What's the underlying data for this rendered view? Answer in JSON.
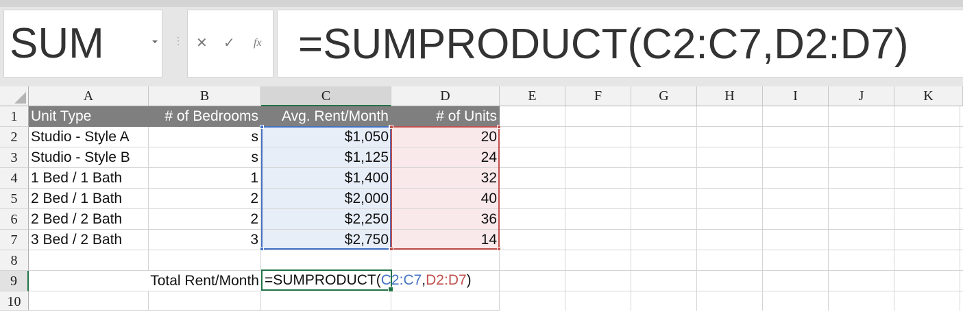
{
  "name_box": {
    "value": "SUM"
  },
  "formula_bar": {
    "cancel_glyph": "✕",
    "enter_glyph": "✓",
    "fx_label": "fx",
    "formula": "=SUMPRODUCT(C2:C7,D2:D7)"
  },
  "columns": [
    "A",
    "B",
    "C",
    "D",
    "E",
    "F",
    "G",
    "H",
    "I",
    "J",
    "K"
  ],
  "rows": [
    "1",
    "2",
    "3",
    "4",
    "5",
    "6",
    "7",
    "8",
    "9",
    "10"
  ],
  "table": {
    "headers": [
      "Unit Type",
      "# of Bedrooms",
      "Avg. Rent/Month",
      "# of Units"
    ],
    "rows": [
      [
        "Studio - Style A",
        "s",
        "$1,050",
        "20"
      ],
      [
        "Studio - Style B",
        "s",
        "$1,125",
        "24"
      ],
      [
        "1 Bed / 1 Bath",
        "1",
        "$1,400",
        "32"
      ],
      [
        "2 Bed / 1 Bath",
        "2",
        "$2,000",
        "40"
      ],
      [
        "2 Bed / 2 Bath",
        "2",
        "$2,250",
        "36"
      ],
      [
        "3 Bed / 2 Bath",
        "3",
        "$2,750",
        "14"
      ]
    ]
  },
  "total": {
    "label": "Total Rent/Month",
    "edit_prefix": "=SUMPRODUCT(",
    "ref1": "C2:C7",
    "sep": ",",
    "ref2": "D2:D7",
    "suffix": ")"
  },
  "colors": {
    "range1": "#4472c4",
    "range2": "#c0504d",
    "active": "#217346",
    "header_fill": "#7f7f7f"
  }
}
